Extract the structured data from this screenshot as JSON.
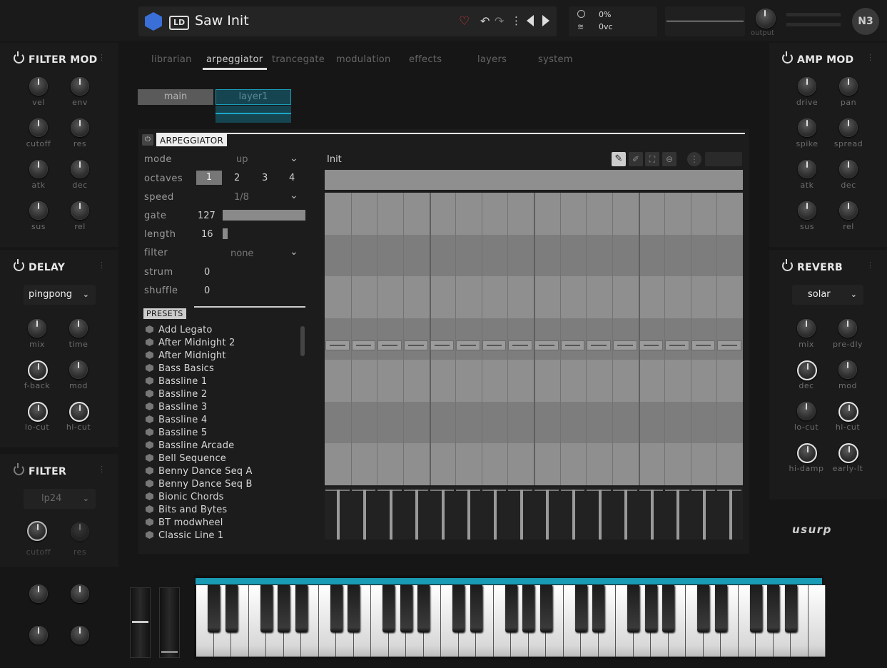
{
  "header": {
    "badge": "LD",
    "patch_name": "Saw Init",
    "stat_cpu": "0",
    "stat_cpu_unit": "%",
    "stat_voices": "0",
    "stat_voices_unit": "vc",
    "output_label": "output",
    "brand_short": "N3",
    "accent": "#1a9bb5",
    "heart_color": "#e0383e"
  },
  "tabs": [
    "librarian",
    "arpeggiator",
    "trancegate",
    "modulation",
    "effects",
    "layers",
    "system"
  ],
  "active_tab": "arpeggiator",
  "layer_tabs": {
    "main": "main",
    "layer1": "layer1"
  },
  "filter_mod": {
    "title": "FILTER MOD",
    "knobs": [
      "vel",
      "env",
      "cutoff",
      "res",
      "atk",
      "dec",
      "sus",
      "rel"
    ]
  },
  "amp_mod": {
    "title": "AMP MOD",
    "knobs": [
      "drive",
      "pan",
      "spike",
      "spread",
      "atk",
      "dec",
      "sus",
      "rel"
    ]
  },
  "delay": {
    "title": "DELAY",
    "mode": "pingpong",
    "knobs": [
      "mix",
      "time",
      "f-back",
      "mod",
      "lo-cut",
      "hi-cut"
    ]
  },
  "reverb": {
    "title": "REVERB",
    "mode": "solar",
    "knobs": [
      "mix",
      "pre-dly",
      "dec",
      "mod",
      "lo-cut",
      "hi-cut",
      "hi-damp",
      "early-lt"
    ]
  },
  "filter": {
    "title": "FILTER",
    "mode": "lp24",
    "knobs": [
      "cutoff",
      "res"
    ]
  },
  "brand_logo": "usurp",
  "arp": {
    "title": "ARPEGGIATOR",
    "pattern_name": "Init",
    "params": {
      "mode_label": "mode",
      "mode_value": "up",
      "octaves_label": "octaves",
      "octaves": [
        "1",
        "2",
        "3",
        "4"
      ],
      "octaves_selected": "1",
      "speed_label": "speed",
      "speed_value": "1/8",
      "gate_label": "gate",
      "gate_value": "127",
      "gate_fraction": 1.0,
      "length_label": "length",
      "length_value": "16",
      "filter_label": "filter",
      "filter_value": "none",
      "strum_label": "strum",
      "strum_value": "0",
      "shuffle_label": "shuffle",
      "shuffle_value": "0"
    },
    "presets_title": "PRESETS",
    "presets": [
      "Add Legato",
      "After Midnight 2",
      "After Midnight",
      "Bass Basics",
      "Bassline 1",
      "Bassline 2",
      "Bassline 3",
      "Bassline 4",
      "Bassline 5",
      "Bassline Arcade",
      "Bell Sequence",
      "Benny Dance Seq A",
      "Benny Dance Seq B",
      "Bionic Chords",
      "Bits and Bytes",
      "BT modwheel",
      "Classic Line 1"
    ],
    "steps": 16,
    "step_values": [
      0.5,
      0.5,
      0.5,
      0.5,
      0.5,
      0.5,
      0.5,
      0.5,
      0.5,
      0.5,
      0.5,
      0.5,
      0.5,
      0.5,
      0.5,
      0.5
    ],
    "step_velocity": [
      1,
      1,
      1,
      1,
      1,
      1,
      1,
      1,
      1,
      1,
      1,
      1,
      1,
      1,
      1,
      1
    ]
  }
}
